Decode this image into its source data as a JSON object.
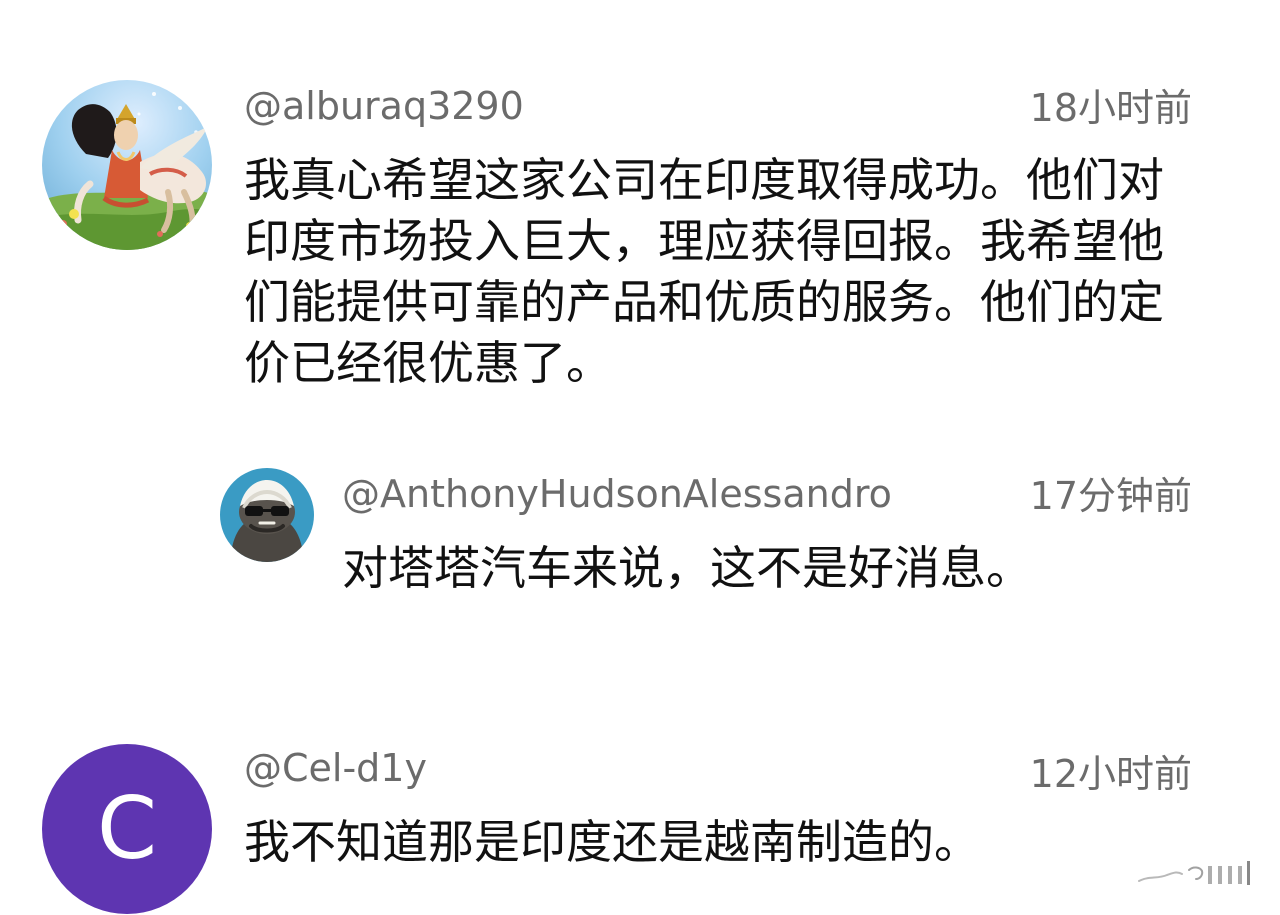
{
  "comments": [
    {
      "username": "@alburaq3290",
      "timestamp": "18小时前",
      "text": "我真心希望这家公司在印度取得成功。他们对印度市场投入巨大，理应获得回报。我希望他们能提供可靠的产品和优质的服务。他们的定价已经很优惠了。",
      "avatar_icon": "painted-figure-avatar"
    },
    {
      "username": "@AnthonyHudsonAlessandro",
      "timestamp": "17分钟前",
      "text": "对塔塔汽车来说，这不是好消息。",
      "avatar_icon": "badger-with-sunglasses-avatar"
    },
    {
      "username": "@Cel-d1y",
      "timestamp": "12小时前",
      "text": "我不知道那是印度还是越南制造的。",
      "avatar_letter": "C",
      "avatar_color": "#5e35b1"
    }
  ],
  "colors": {
    "meta_text": "#6b6b6b",
    "body_text": "#111111",
    "background": "#ffffff"
  }
}
